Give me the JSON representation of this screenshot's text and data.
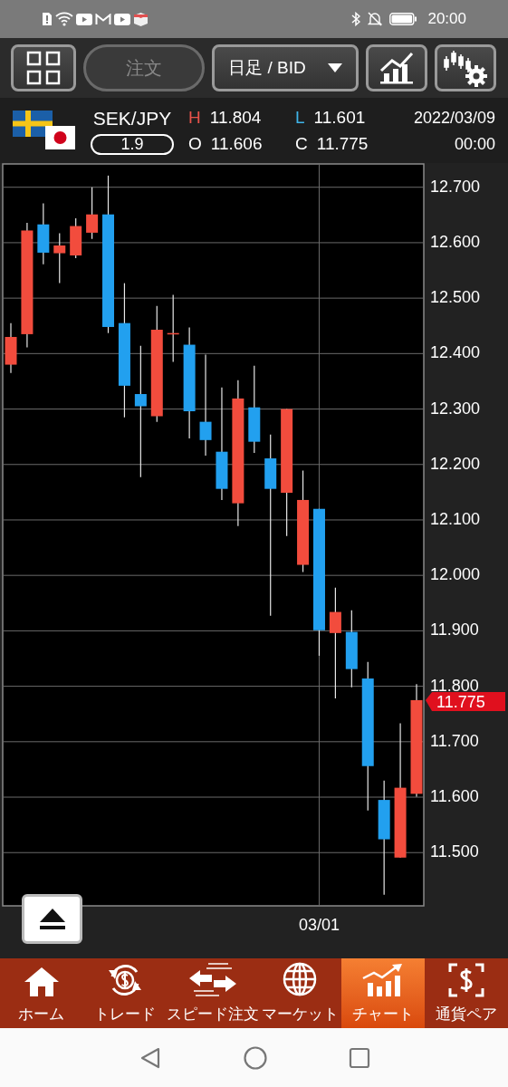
{
  "status_bar": {
    "time": "20:00"
  },
  "toolbar": {
    "order_button": {
      "label": "注文",
      "disabled": true
    },
    "timeframe_dropdown": {
      "value": "日足 / BID"
    }
  },
  "quote": {
    "pair": "SEK/JPY",
    "spread": "1.9",
    "date": "2022/03/09",
    "time": "00:00",
    "fields": [
      {
        "label": "H",
        "value": "11.804",
        "color": "#e8524a"
      },
      {
        "label": "L",
        "value": "11.601",
        "color": "#3fb4e8"
      },
      {
        "label": "O",
        "value": "11.606",
        "color": "#ffffff"
      },
      {
        "label": "C",
        "value": "11.775",
        "color": "#ffffff"
      }
    ]
  },
  "chart": {
    "chart_data": {
      "type": "candlestick",
      "grid": true,
      "ylim": [
        11.404,
        12.742
      ],
      "yticks": [
        {
          "value": 11.5,
          "label": "11.500"
        },
        {
          "value": 11.6,
          "label": "11.600"
        },
        {
          "value": 11.7,
          "label": "11.700"
        },
        {
          "value": 11.8,
          "label": "11.800"
        },
        {
          "value": 11.9,
          "label": "11.900"
        },
        {
          "value": 12.0,
          "label": "12.000"
        },
        {
          "value": 12.1,
          "label": "12.100"
        },
        {
          "value": 12.2,
          "label": "12.200"
        },
        {
          "value": 12.3,
          "label": "12.300"
        },
        {
          "value": 12.4,
          "label": "12.400"
        },
        {
          "value": 12.5,
          "label": "12.500"
        },
        {
          "value": 12.6,
          "label": "12.600"
        },
        {
          "value": 12.7,
          "label": "12.700"
        }
      ],
      "ohlc": [
        [
          12.38,
          12.455,
          12.365,
          12.43
        ],
        [
          12.435,
          12.636,
          12.411,
          12.622
        ],
        [
          12.633,
          12.671,
          12.561,
          12.582
        ],
        [
          12.581,
          12.617,
          12.527,
          12.595
        ],
        [
          12.577,
          12.644,
          12.572,
          12.63
        ],
        [
          12.618,
          12.7,
          12.607,
          12.651
        ],
        [
          12.651,
          12.721,
          12.437,
          12.448
        ],
        [
          12.455,
          12.527,
          12.285,
          12.342
        ],
        [
          12.327,
          12.414,
          12.177,
          12.305
        ],
        [
          12.287,
          12.486,
          12.277,
          12.443
        ],
        [
          12.437,
          12.506,
          12.385,
          12.437
        ],
        [
          12.416,
          12.447,
          12.247,
          12.296
        ],
        [
          12.277,
          12.398,
          12.216,
          12.244
        ],
        [
          12.223,
          12.339,
          12.136,
          12.156
        ],
        [
          12.13,
          12.352,
          12.089,
          12.319
        ],
        [
          12.303,
          12.378,
          12.221,
          12.241
        ],
        [
          12.211,
          12.254,
          11.927,
          12.156
        ],
        [
          12.149,
          12.3,
          12.071,
          12.3
        ],
        [
          12.019,
          12.189,
          12.006,
          12.136
        ],
        [
          12.12,
          12.12,
          11.855,
          11.901
        ],
        [
          11.896,
          11.978,
          11.778,
          11.934
        ],
        [
          11.898,
          11.937,
          11.798,
          11.831
        ],
        [
          11.814,
          11.844,
          11.576,
          11.656
        ],
        [
          11.595,
          11.63,
          11.424,
          11.524
        ],
        [
          11.491,
          11.733,
          11.491,
          11.617
        ],
        [
          11.606,
          11.804,
          11.601,
          11.775
        ]
      ],
      "annotations": [
        "03/01",
        "11.775"
      ]
    }
  },
  "bottom_nav": [
    {
      "label": "ホーム",
      "selected": false
    },
    {
      "label": "トレード",
      "selected": false
    },
    {
      "label": "スピード注文",
      "selected": false
    },
    {
      "label": "マーケット",
      "selected": false
    },
    {
      "label": "チャート",
      "selected": true
    },
    {
      "label": "通貨ペア",
      "selected": false
    }
  ]
}
